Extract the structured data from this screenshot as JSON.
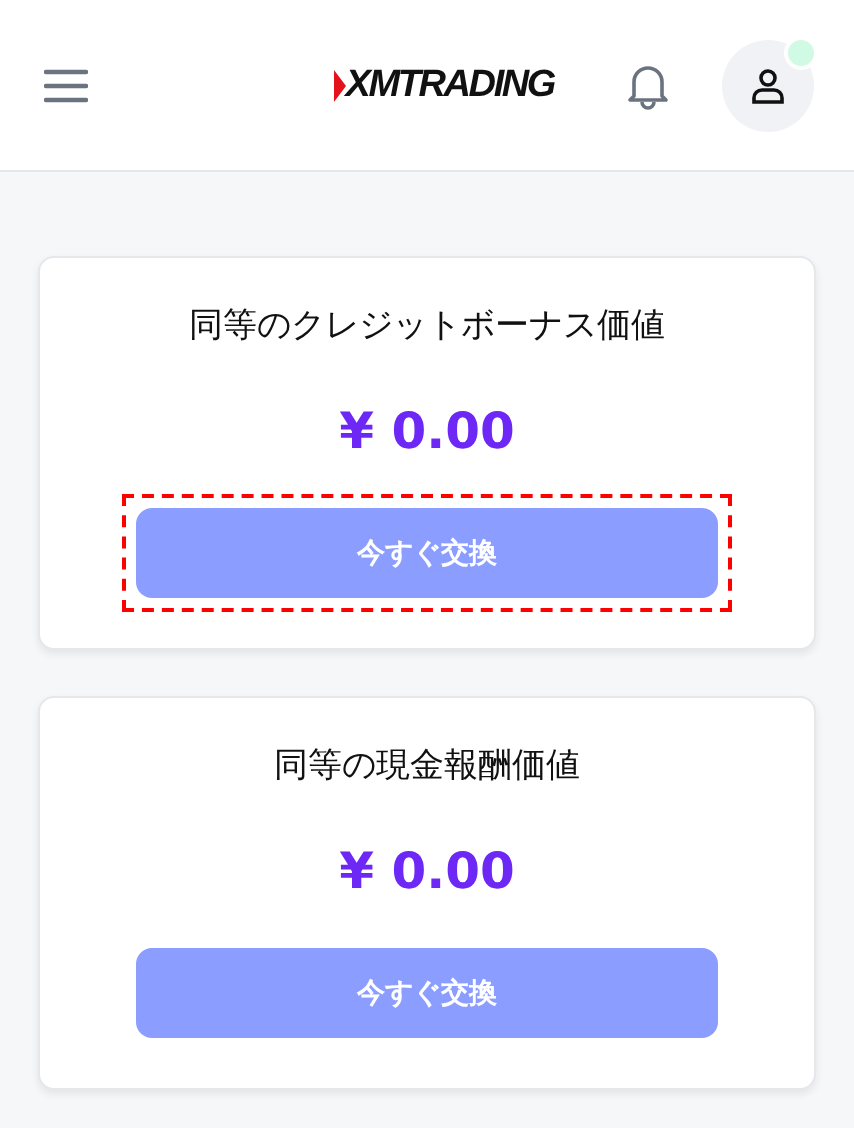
{
  "header": {
    "logo": "XMTRADING",
    "notification_dot": true
  },
  "cards": [
    {
      "title": "同等のクレジットボーナス価値",
      "amount": "¥ 0.00",
      "button": "今すぐ交換",
      "highlighted": true
    },
    {
      "title": "同等の現金報酬価値",
      "amount": "¥ 0.00",
      "button": "今すぐ交換",
      "highlighted": false
    }
  ]
}
